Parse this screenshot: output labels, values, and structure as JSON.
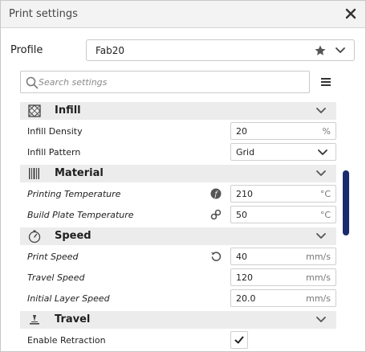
{
  "window": {
    "title": "Print settings"
  },
  "profile": {
    "label": "Profile",
    "value": "Fab20"
  },
  "search": {
    "placeholder": "Search settings"
  },
  "categories": {
    "infill": "Infill",
    "material": "Material",
    "speed": "Speed",
    "travel": "Travel"
  },
  "settings": {
    "infill_density": {
      "label": "Infill Density",
      "value": "20",
      "unit": "%"
    },
    "infill_pattern": {
      "label": "Infill Pattern",
      "value": "Grid"
    },
    "printing_temperature": {
      "label": "Printing Temperature",
      "value": "210",
      "unit": "°C"
    },
    "build_plate_temperature": {
      "label": "Build Plate Temperature",
      "value": "50",
      "unit": "°C"
    },
    "print_speed": {
      "label": "Print Speed",
      "value": "40",
      "unit": "mm/s"
    },
    "travel_speed": {
      "label": "Travel Speed",
      "value": "120",
      "unit": "mm/s"
    },
    "initial_layer_speed": {
      "label": "Initial Layer Speed",
      "value": "20.0",
      "unit": "mm/s"
    },
    "enable_retraction": {
      "label": "Enable Retraction",
      "checked": true
    }
  },
  "colors": {
    "scrollbar": "#1a2b6d",
    "category_bg": "#ececec"
  },
  "icons": [
    "close-icon",
    "star-icon",
    "chevron-down-icon",
    "search-icon",
    "menu-icon",
    "infill-icon",
    "material-icon",
    "speed-icon",
    "travel-icon",
    "formula-icon",
    "link-icon",
    "reset-icon",
    "checkmark-icon"
  ]
}
